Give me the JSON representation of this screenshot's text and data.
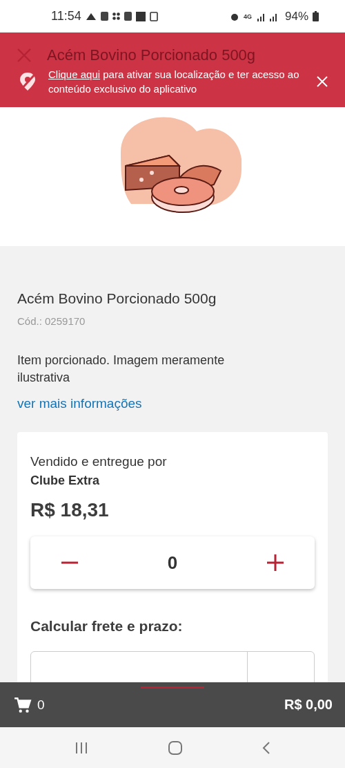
{
  "status_bar": {
    "time": "11:54",
    "network": "4G",
    "battery": "94%"
  },
  "header": {
    "title": "Acém Bovino Porcionado 500g"
  },
  "location_banner": {
    "link": "Clique aqui",
    "message": " para ativar sua localização e ter acesso ao conteúdo exclusivo do aplicativo"
  },
  "product": {
    "name": "Acém Bovino Porcionado 500g",
    "code": "Cód.: 0259170",
    "description": "Item porcionado. Imagem meramente ilustrativa",
    "more_link": "ver mais informações"
  },
  "offer": {
    "sold_by_label": "Vendido e entregue por",
    "seller": "Clube Extra",
    "price": "R$ 18,31",
    "quantity": "0"
  },
  "shipping": {
    "title": "Calcular frete e prazo:"
  },
  "cart_bar": {
    "count": "0",
    "total": "R$ 0,00"
  }
}
